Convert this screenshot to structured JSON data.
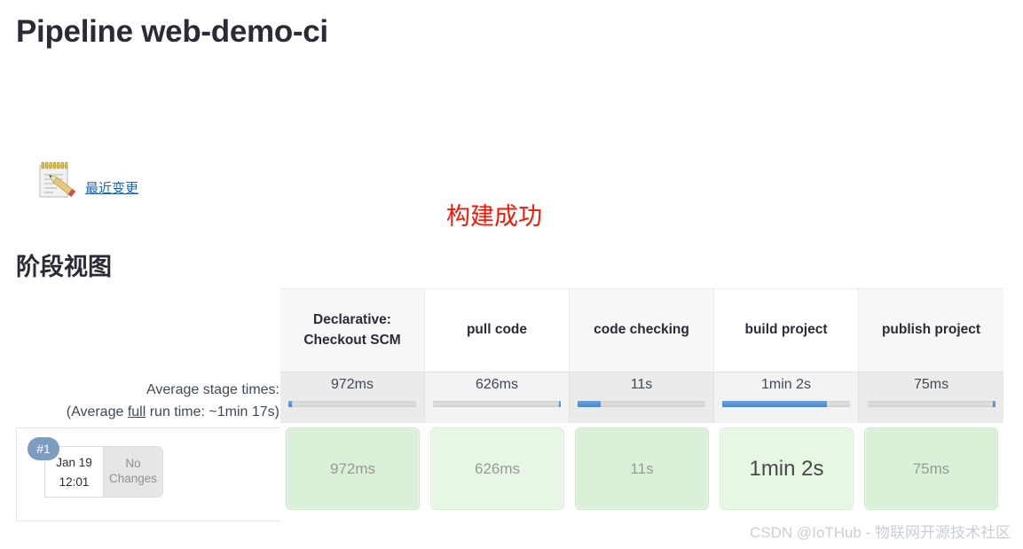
{
  "page": {
    "title": "Pipeline web-demo-ci",
    "build_status": "构建成功",
    "section_heading": "阶段视图"
  },
  "changes": {
    "link_label": "最近变更",
    "icon": "notepad-pencil-icon"
  },
  "legend": {
    "line1": "Average stage times:",
    "line2_prefix": "(Average ",
    "line2_underlined": "full",
    "line2_suffix": " run time: ~1min 17s)"
  },
  "stage_table": {
    "headers": [
      "Declarative: Checkout SCM",
      "pull code",
      "code checking",
      "build project",
      "publish project"
    ],
    "average_times": [
      "972ms",
      "626ms",
      "11s",
      "1min 2s",
      "75ms"
    ],
    "average_bar_percent": [
      3,
      2,
      18,
      82,
      1
    ]
  },
  "build": {
    "number": "#1",
    "date": "Jan 19",
    "time": "12:01",
    "changes": "No Changes",
    "stage_times": [
      "972ms",
      "626ms",
      "11s",
      "1min 2s",
      "75ms"
    ],
    "primary_index": 3
  },
  "watermark": "CSDN @IoTHub - 物联网开源技术社区",
  "colors": {
    "title": "#2b2b38",
    "status_red": "#fa1505",
    "link_blue": "#1b64b6",
    "bar_blue": "#4a86d0",
    "stage_green": "#daf0d9",
    "badge_blue": "#7d9cc2"
  }
}
